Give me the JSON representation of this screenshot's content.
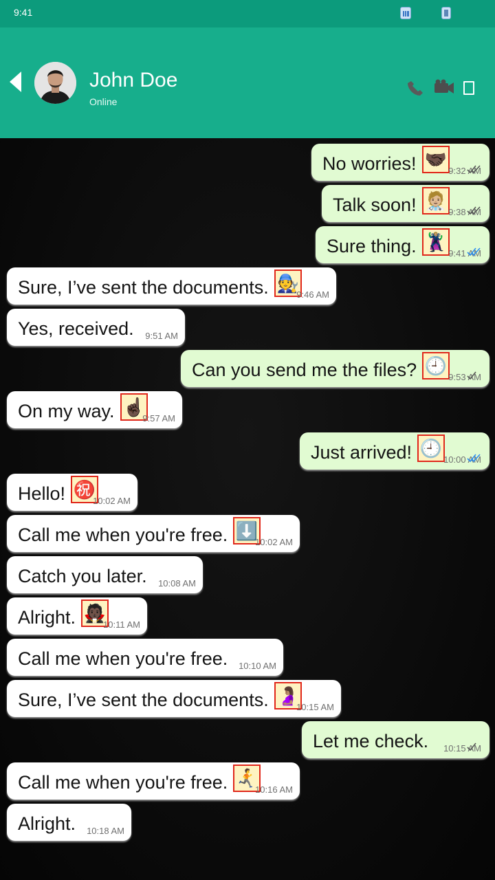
{
  "status_bar": {
    "time": "9:41"
  },
  "header": {
    "contact_name": "John Doe",
    "contact_status": "Online"
  },
  "theme": {
    "header_color": "#17ae8c",
    "outgoing_bubble": "#e1fbd2",
    "read_tick_color": "#2a8cf0"
  },
  "messages": [
    {
      "dir": "out",
      "text": "No worries!",
      "emoji": "🤝🏿",
      "time": "9:32 AM",
      "ticks": "double-grey"
    },
    {
      "dir": "out",
      "text": "Talk soon!",
      "emoji": "🧑🏼‍⚕️",
      "time": "9:38 AM",
      "ticks": "double-grey"
    },
    {
      "dir": "out",
      "text": "Sure thing.",
      "emoji": "🦹🏼‍♀️",
      "time": "9:41 AM",
      "ticks": "double-blue"
    },
    {
      "dir": "in",
      "text": "Sure, I’ve sent the documents.",
      "emoji": "🧑‍🔧",
      "time": "9:46 AM"
    },
    {
      "dir": "in",
      "text": "Yes, received.",
      "emoji": "",
      "time": "9:51 AM"
    },
    {
      "dir": "out",
      "text": "Can you send me the files?",
      "emoji": "🕘",
      "time": "9:53 AM",
      "ticks": "single"
    },
    {
      "dir": "in",
      "text": "On my way.",
      "emoji": "☝🏿",
      "time": "9:57 AM"
    },
    {
      "dir": "out",
      "text": "Just arrived!",
      "emoji": "🕘",
      "time": "10:00 AM",
      "ticks": "double-blue"
    },
    {
      "dir": "in",
      "text": "Hello!",
      "emoji": "㊗️",
      "time": "10:02 AM"
    },
    {
      "dir": "in",
      "text": "Call me when you're free.",
      "emoji": "⬇️",
      "time": "10:02 AM"
    },
    {
      "dir": "in",
      "text": "Catch you later.",
      "emoji": "",
      "time": "10:08 AM"
    },
    {
      "dir": "in",
      "text": "Alright.",
      "emoji": "🧛🏿",
      "time": "10:11 AM"
    },
    {
      "dir": "in",
      "text": "Call me when you're free.",
      "emoji": "",
      "time": "10:10 AM"
    },
    {
      "dir": "in",
      "text": "Sure, I’ve sent the documents.",
      "emoji": "🤰🏽",
      "time": "10:15 AM"
    },
    {
      "dir": "out",
      "text": "Let me check.",
      "emoji": "",
      "time": "10:15 AM",
      "ticks": "single"
    },
    {
      "dir": "in",
      "text": "Call me when you're free.",
      "emoji": "🏃‍➡️",
      "time": "10:16 AM"
    },
    {
      "dir": "in",
      "text": "Alright.",
      "emoji": "",
      "time": "10:18 AM"
    }
  ]
}
